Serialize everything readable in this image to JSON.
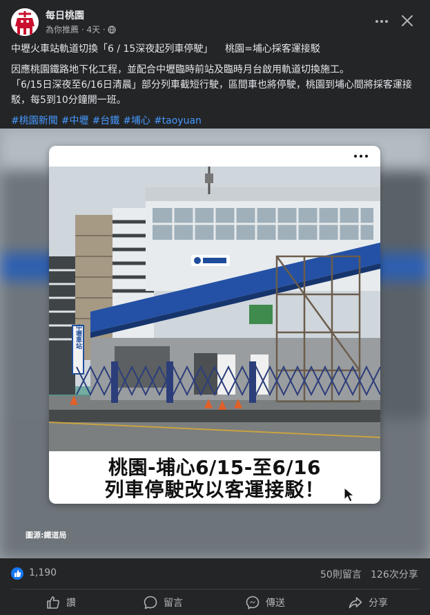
{
  "header": {
    "page_name": "每日桃園",
    "meta": "為你推薦 · 4天 ·"
  },
  "post": {
    "line1_a": "中壢火車站軌道切換「6 / 15深夜起列車停駛」",
    "line1_b": "桃園=埔心採客運接駁",
    "line2": "因應桃園鐵路地下化工程，並配合中壢臨時前站及臨時月台啟用軌道切換施工。",
    "line3": "「6/15日深夜至6/16日清晨」部分列車截短行駛，區間車也將停駛，桃園到埔心間將採客運接駁，每5到10分鐘開一班。",
    "hashtags": [
      "#桃園新聞",
      "#中壢",
      "#台鐵",
      "#埔心",
      "#taoyuan"
    ]
  },
  "image": {
    "caption_line1": "桃園-埔心6/15-至6/16",
    "caption_line2": "列車停駛改以客運接駁！",
    "source": "圖源:鐵道局",
    "sign_text": "中壢車站"
  },
  "stats": {
    "likes": "1,190",
    "comments": "50則留言",
    "shares": "126次分享"
  },
  "actions": {
    "like": "讚",
    "comment": "留言",
    "send": "傳送",
    "share": "分享"
  },
  "colors": {
    "background": "#242526",
    "text": "#e4e6eb",
    "secondary": "#b0b3b8",
    "hashtag": "#4599ff",
    "like_blue": "#1877f2"
  }
}
